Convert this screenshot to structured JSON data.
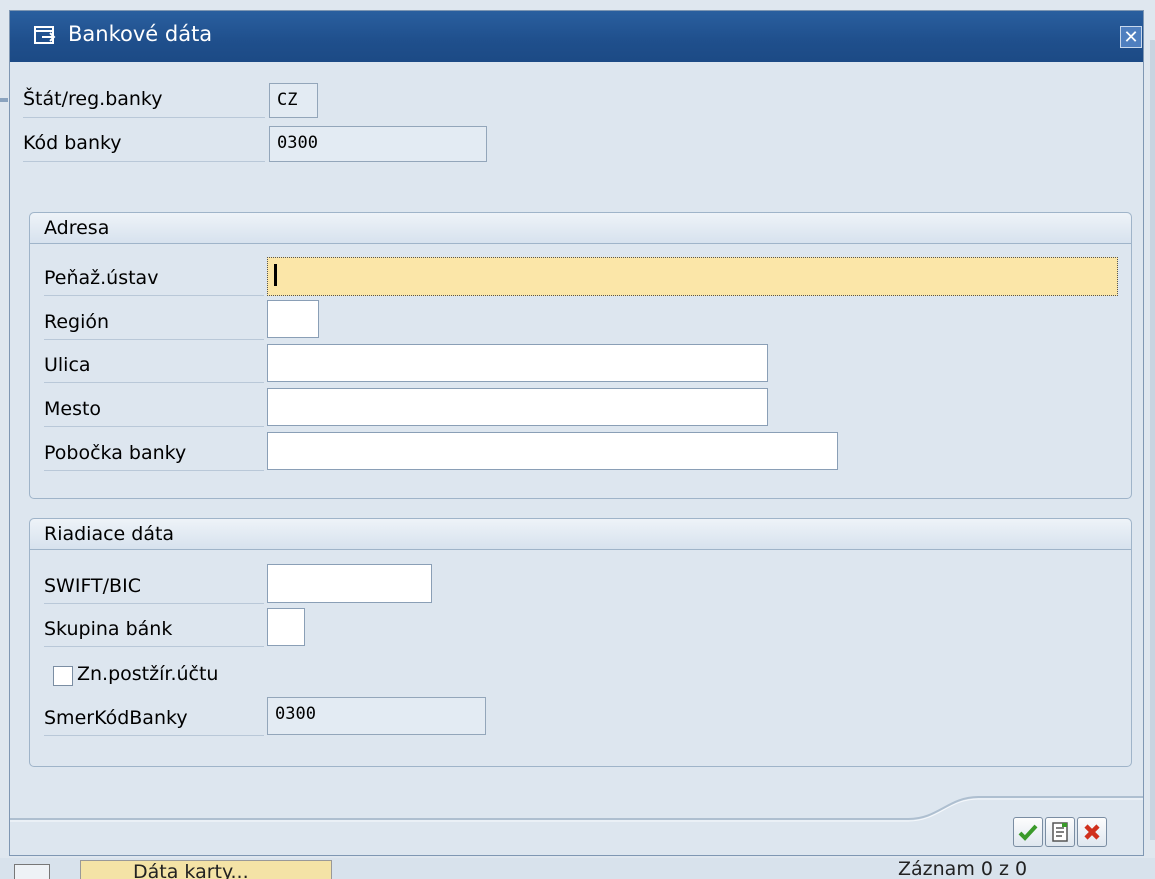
{
  "window": {
    "title": "Bankové dáta"
  },
  "header_fields": [
    {
      "label": "Štát/reg.banky",
      "value": "CZ"
    },
    {
      "label": "Kód banky",
      "value": "0300"
    }
  ],
  "address_group": {
    "title": "Adresa",
    "fields": [
      {
        "label": "Peňaž.ústav",
        "value": ""
      },
      {
        "label": "Región",
        "value": ""
      },
      {
        "label": "Ulica",
        "value": ""
      },
      {
        "label": "Mesto",
        "value": ""
      },
      {
        "label": "Pobočka banky",
        "value": ""
      }
    ]
  },
  "control_group": {
    "title": "Riadiace dáta",
    "swift_label": "SWIFT/BIC",
    "swift_value": "",
    "bank_group_label": "Skupina bánk",
    "bank_group_value": "",
    "postal_checkbox_label": "Zn.postžír.účtu",
    "postal_checkbox_checked": false,
    "bank_number_label": "SmerKódBanky",
    "bank_number_value": "0300"
  },
  "footer_buttons": [
    {
      "icon": "checkmark-icon",
      "color": "#3a9a2a"
    },
    {
      "icon": "document-icon",
      "color": "#555555"
    },
    {
      "icon": "cancel-x-icon",
      "color": "#d0301c"
    }
  ],
  "background": {
    "bottom_field_text": "Dáta karty...",
    "record_text": "Záznam 0 z 0"
  }
}
